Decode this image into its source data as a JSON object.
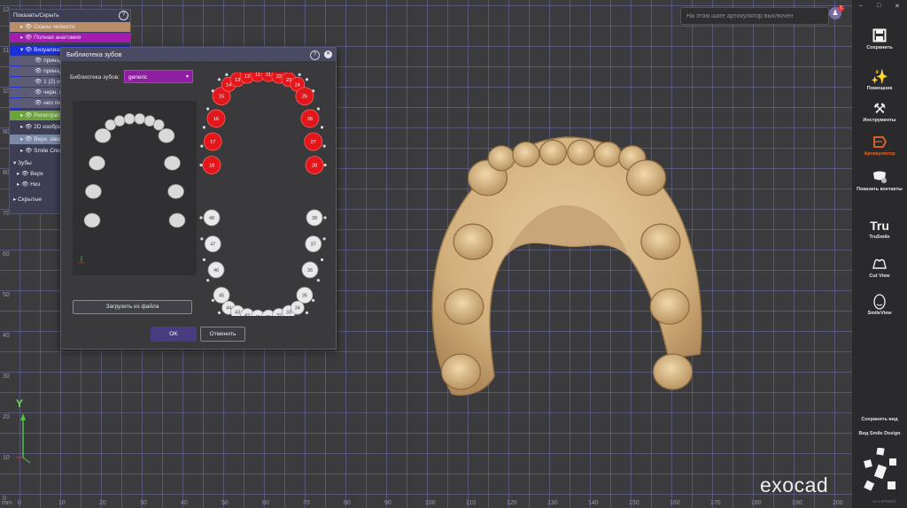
{
  "viewport": {
    "y_ticks": [
      "12",
      "11",
      "10",
      "90",
      "80",
      "70",
      "60",
      "50",
      "40",
      "30",
      "20",
      "10",
      "0"
    ],
    "x_ticks": [
      "0",
      "10",
      "20",
      "30",
      "40",
      "50",
      "60",
      "70",
      "80",
      "90",
      "100",
      "110",
      "120",
      "130",
      "140",
      "150",
      "160",
      "170",
      "180",
      "190",
      "200"
    ],
    "unit_label": "mm",
    "axis_y_label": "Y",
    "notice_text": "На этом шаге артикулятор выключен",
    "notification_count": "1",
    "logo_text": "exocad"
  },
  "show_hide_panel": {
    "title": "Показать/Скрыть",
    "rows": [
      {
        "label": "Показать/Скрыть",
        "bg": "#3d3d54"
      },
      {
        "label": "Сканы челюсти",
        "bg": "#b88e68"
      },
      {
        "label": "Полная анатомия",
        "bg": "#a41cb0"
      },
      {
        "label": "Визуализация",
        "bg": "#1c2fd6"
      },
      {
        "label": "принадл",
        "bg": "#5c5c78"
      },
      {
        "label": "принадл",
        "bg": "#5c5c78"
      },
      {
        "label": "1 (2) из",
        "bg": "#5c5c78"
      },
      {
        "label": "черн. с",
        "bg": "#5c5c78"
      },
      {
        "label": "нео пе",
        "bg": "#5c5c78"
      },
      {
        "label": "Регистрати",
        "bg": "#6aa43a"
      },
      {
        "label": "2D изображ",
        "bg": "#3d3d54"
      },
      {
        "label": "Верх. закс",
        "bg": "#7a88a6"
      },
      {
        "label": "Smile Creat",
        "bg": "#3d3d54"
      },
      {
        "label": "Зубы",
        "bg": "#3d3d54"
      },
      {
        "label": "Верх",
        "bg": "#3d3d54"
      },
      {
        "label": "Низ",
        "bg": "#3d3d54"
      },
      {
        "label": "Скрытые",
        "bg": "#3d3d54"
      }
    ]
  },
  "dialog": {
    "title": "Библиотека зубов",
    "library_label": "Библиотека зубов:",
    "library_value": "generic",
    "load_button": "Загрузить из файла",
    "ok_button": "OK",
    "cancel_button": "Отменить",
    "upper_teeth": [
      "18",
      "17",
      "16",
      "15",
      "14",
      "13",
      "12",
      "11",
      "21",
      "22",
      "23",
      "24",
      "25",
      "26",
      "27",
      "28"
    ],
    "lower_teeth": [
      "48",
      "47",
      "46",
      "45",
      "44",
      "43",
      "42",
      "41",
      "31",
      "32",
      "33",
      "34",
      "35",
      "36",
      "37",
      "38"
    ],
    "selected_color": "#e2161b",
    "unselected_color": "#e9e9e9"
  },
  "toolbar": {
    "window_controls": [
      "–",
      "□",
      "✕"
    ],
    "buttons": [
      {
        "label": "Сохранить",
        "icon": "save-icon"
      },
      {
        "label": "Помощник",
        "icon": "wand-icon"
      },
      {
        "label": "Инструменты",
        "icon": "tools-icon"
      },
      {
        "label": "Артикулятор",
        "icon": "articulator-icon"
      },
      {
        "label": "Показать контакты",
        "icon": "contacts-icon"
      },
      {
        "label": "TruSmile",
        "icon": "trusmile-icon"
      },
      {
        "label": "Cut View",
        "icon": "cutview-icon"
      },
      {
        "label": "SmileView",
        "icon": "smileview-icon"
      }
    ],
    "save_view": "Сохранить вид",
    "smile_design_view": "Вид Smile Design",
    "version": "v3.1-8706/04",
    "accent_color": "#e8682a"
  }
}
